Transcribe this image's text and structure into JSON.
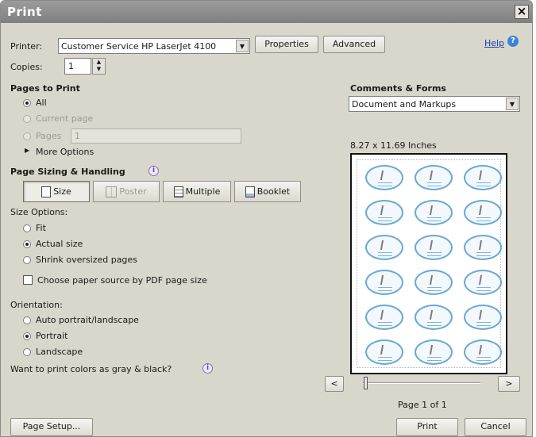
{
  "window": {
    "title": "Print",
    "close_glyph": "×"
  },
  "printer": {
    "label": "Printer:",
    "selected": "Customer Service HP LaserJet 4100",
    "properties_label": "Properties",
    "advanced_label": "Advanced",
    "help_label": "Help"
  },
  "copies": {
    "label": "Copies:",
    "value": "1"
  },
  "pages_to_print": {
    "heading": "Pages to Print",
    "all_label": "All",
    "current_page_label": "Current page",
    "pages_label": "Pages",
    "pages_value": "1",
    "more_options_label": "More Options"
  },
  "sizing": {
    "heading": "Page Sizing & Handling",
    "tabs": [
      {
        "label": "Size"
      },
      {
        "label": "Poster"
      },
      {
        "label": "Multiple"
      },
      {
        "label": "Booklet"
      }
    ],
    "size_options_label": "Size Options:",
    "fit_label": "Fit",
    "actual_size_label": "Actual size",
    "shrink_label": "Shrink oversized pages",
    "paper_source_label": "Choose paper source by PDF page size",
    "orientation_label": "Orientation:",
    "auto_label": "Auto portrait/landscape",
    "portrait_label": "Portrait",
    "landscape_label": "Landscape",
    "gray_question": "Want to print colors as gray & black?"
  },
  "comments_forms": {
    "heading": "Comments & Forms",
    "selected": "Document and Markups"
  },
  "preview": {
    "dimensions": "8.27 x 11.69 Inches",
    "page_status": "Page 1 of 1",
    "prev_label": "<",
    "next_label": ">"
  },
  "footer": {
    "page_setup_label": "Page Setup...",
    "print_label": "Print",
    "cancel_label": "Cancel"
  },
  "colors": {
    "dialog_bg": "#d9d6cc",
    "titlebar": "#8c8c8c",
    "help_link": "#1a3fb0",
    "label_outline": "#6aa9d6"
  }
}
